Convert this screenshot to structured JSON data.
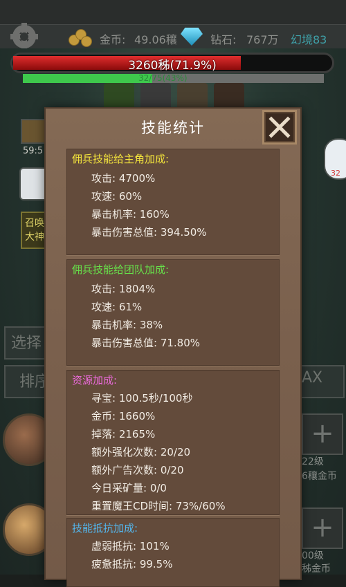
{
  "topbar": {
    "gold_label": "金币:",
    "gold_value": "49.06穰",
    "diamond_label": "钻石:",
    "diamond_value": "767万",
    "realm": "幻境83"
  },
  "boss": {
    "hp_text": "3260秭(71.9%)",
    "hp_fraction": 0.719,
    "xp_text": "32/75(43%)",
    "xp_fraction": 0.43
  },
  "background": {
    "timer": "59:5",
    "summon_1": "召唤",
    "summon_2": "大神",
    "select_label": "选择",
    "rank_label": "排序",
    "max_label": "AX",
    "level_1": "22级",
    "cost_1": "6穰金币",
    "level_2": "00级",
    "cost_2": "秭金币",
    "badge": "32"
  },
  "dialog": {
    "title": "技能统计",
    "sections": [
      {
        "title": "佣兵技能给主角加成:",
        "title_color": "#f5e63c",
        "rows": [
          "攻击:  4700%",
          "攻速:  60%",
          "暴击机率:  160%",
          "暴击伤害总值:  394.50%"
        ]
      },
      {
        "title": "佣兵技能给团队加成:",
        "title_color": "#67e24a",
        "rows": [
          "攻击:  1804%",
          "攻速:  61%",
          "暴击机率:  38%",
          "暴击伤害总值:  71.80%"
        ]
      },
      {
        "title": "资源加成:",
        "title_color": "#e96ad8",
        "rows": [
          "寻宝:  100.5秒/100秒",
          "金币:  1660%",
          "掉落:  2165%",
          "额外强化次数:  20/20",
          "额外广告次数:  0/20",
          "今日采矿量:  0/0",
          "重置魔王CD时间:  73%/60%"
        ]
      },
      {
        "title": "技能抵抗加成:",
        "title_color": "#53b8f0",
        "rows": [
          "虚弱抵抗:  101%",
          "疲惫抵抗:  99.5%"
        ]
      }
    ]
  }
}
